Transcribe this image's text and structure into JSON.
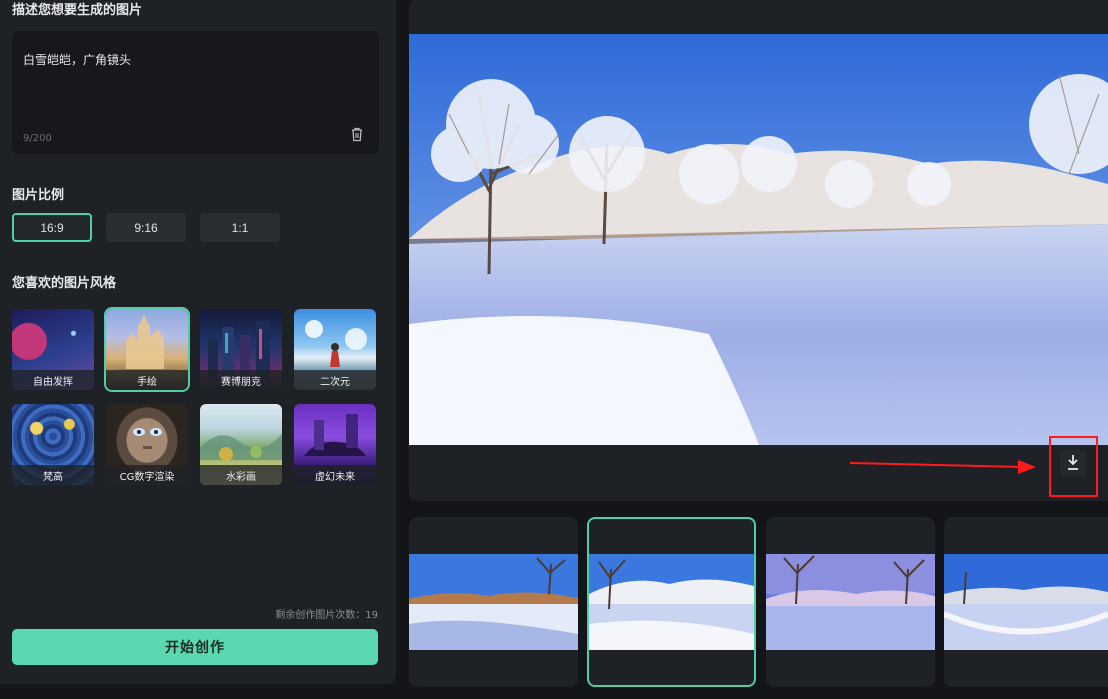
{
  "prompt": {
    "title": "描述您想要生成的图片",
    "text": "白雪皑皑，广角镜头",
    "count": "9/200"
  },
  "ratio": {
    "title": "图片比例",
    "options": [
      "16:9",
      "9:16",
      "1:1"
    ],
    "selected": "16:9"
  },
  "styles": {
    "title": "您喜欢的图片风格",
    "items": [
      "自由发挥",
      "手绘",
      "赛博朋克",
      "二次元",
      "梵高",
      "CG数字渲染",
      "水彩画",
      "虚幻未来"
    ],
    "selected": "手绘"
  },
  "footer": {
    "remaining": "剩余创作图片次数：19",
    "start_label": "开始创作"
  },
  "colors": {
    "accent": "#5ad8b1",
    "highlight": "#ff1b1b"
  },
  "icons": {
    "trash": "trash-icon",
    "download": "download-icon"
  },
  "thumbnails": {
    "count": 4,
    "selected_index": 1
  }
}
